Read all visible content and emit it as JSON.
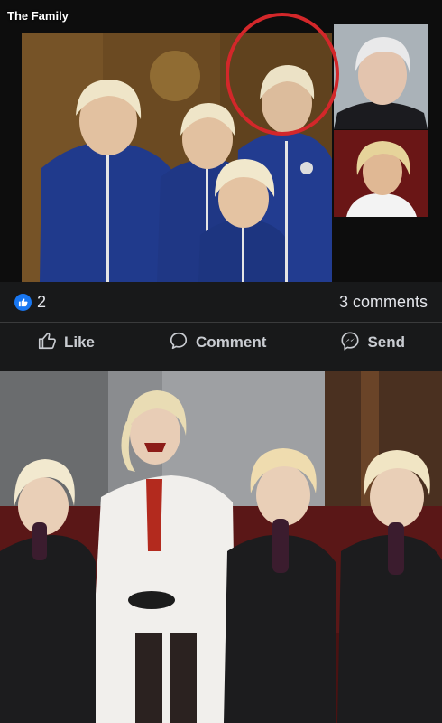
{
  "post_image_top": {
    "caption": "The Family"
  },
  "reactions": {
    "like_count": "2",
    "comments_count": "3 comments"
  },
  "actions": {
    "like_label": "Like",
    "comment_label": "Comment",
    "send_label": "Send"
  },
  "colors": {
    "background": "#18191a",
    "accent": "#1877f2",
    "highlight_circle": "#d3272a"
  }
}
